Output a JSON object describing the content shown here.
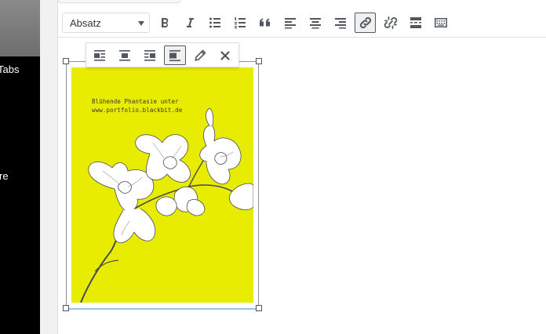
{
  "admin_menu": {
    "items": [
      {
        "label": "Tabs"
      },
      {
        "label": "re"
      }
    ]
  },
  "toolbar": {
    "format_select": {
      "value": "Absatz"
    },
    "buttons": [
      {
        "name": "bold-button",
        "icon": "bold-icon"
      },
      {
        "name": "italic-button",
        "icon": "italic-icon"
      },
      {
        "name": "bulleted-list-button",
        "icon": "bulleted-list-icon"
      },
      {
        "name": "numbered-list-button",
        "icon": "numbered-list-icon"
      },
      {
        "name": "blockquote-button",
        "icon": "blockquote-icon"
      },
      {
        "name": "align-left-button",
        "icon": "align-left-icon"
      },
      {
        "name": "align-center-button",
        "icon": "align-center-icon"
      },
      {
        "name": "align-right-button",
        "icon": "align-right-icon"
      },
      {
        "name": "insert-link-button",
        "icon": "link-icon",
        "active": true
      },
      {
        "name": "remove-link-button",
        "icon": "unlink-icon"
      },
      {
        "name": "read-more-button",
        "icon": "read-more-icon"
      },
      {
        "name": "toolbar-toggle-button",
        "icon": "keyboard-icon"
      }
    ]
  },
  "image_toolbar": {
    "buttons": [
      {
        "name": "image-align-left-button",
        "icon": "align-left-wrap-icon"
      },
      {
        "name": "image-align-center-button",
        "icon": "align-center-wrap-icon"
      },
      {
        "name": "image-align-right-button",
        "icon": "align-right-wrap-icon"
      },
      {
        "name": "image-align-none-button",
        "icon": "align-none-icon",
        "active": true
      },
      {
        "name": "image-edit-button",
        "icon": "pencil-icon"
      },
      {
        "name": "image-remove-button",
        "icon": "close-icon"
      }
    ]
  },
  "image": {
    "line1": "Blühende Phantasie unter",
    "line2": "www.portfolio.blackbit.de",
    "background_color": "#e8ec00"
  },
  "colors": {
    "icon": "#50575e",
    "admin_menu_bg": "#000000",
    "selection_line": "#9ec2e6"
  }
}
